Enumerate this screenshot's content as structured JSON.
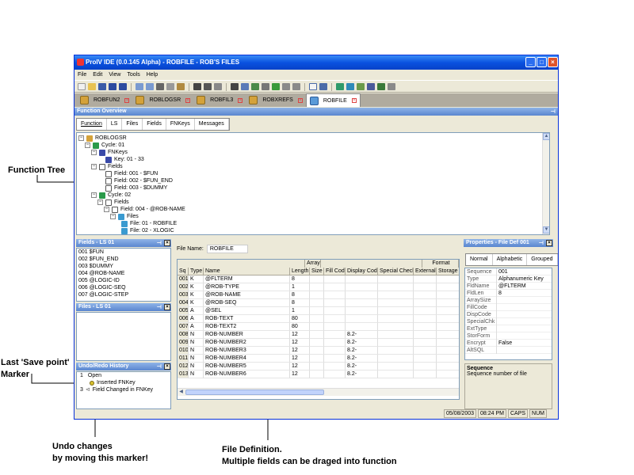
{
  "annotations": {
    "function_tree": "Function Tree",
    "save_point_line1": "Last 'Save point'",
    "save_point_line2": "Marker",
    "undo_line1": "Undo changes",
    "undo_line2": "by moving this marker!",
    "file_def_line1": "File Definition.",
    "file_def_line2": "Multiple fields can be draged into function"
  },
  "window": {
    "title": "ProIV IDE (0.0.145 Alpha) - ROBFILE - ROB'S FILES",
    "min": "_",
    "max": "□",
    "close": "×"
  },
  "menu": [
    "File",
    "Edit",
    "View",
    "Tools",
    "Help"
  ],
  "doc_tabs": [
    {
      "label": "ROBFUN2"
    },
    {
      "label": "ROBLOGSR"
    },
    {
      "label": "ROBFIL3"
    },
    {
      "label": "ROBXREFS"
    },
    {
      "label": "ROBFILE",
      "active": true
    }
  ],
  "function_overview": {
    "title": "Function Overview",
    "tabs": [
      "Function",
      "LS",
      "Files",
      "Fields",
      "FNKeys",
      "Messages"
    ],
    "tree": [
      {
        "label": "ROBLOGSR",
        "icon": "function-icon"
      },
      {
        "label": "Cycle: 01",
        "icon": "cycle-icon"
      },
      {
        "label": "FNKeys",
        "icon": "fnkeys-icon"
      },
      {
        "label": "Key: 01 - 33",
        "icon": "key-icon"
      },
      {
        "label": "Fields",
        "icon": "fields-icon"
      },
      {
        "label": "Field: 001 - $FUN",
        "icon": "field-icon"
      },
      {
        "label": "Field: 002 - $FUN_END",
        "icon": "field-icon"
      },
      {
        "label": "Field: 003 - $DUMMY",
        "icon": "field-icon"
      },
      {
        "label": "Cycle: 02",
        "icon": "cycle-icon"
      },
      {
        "label": "Fields",
        "icon": "fields-icon"
      },
      {
        "label": "Field: 004 - @ROB-NAME",
        "icon": "field-icon"
      },
      {
        "label": "Files",
        "icon": "files-icon"
      },
      {
        "label": "File: 01 - ROBFILE",
        "icon": "file-icon"
      },
      {
        "label": "File: 02 - XLOGIC",
        "icon": "file-icon"
      }
    ]
  },
  "fields_panel": {
    "title": "Fields - LS 01",
    "items": [
      "001 $FUN",
      "002 $FUN_END",
      "003 $DUMMY",
      "004 @ROB-NAME",
      "005 @LOGIC-ID",
      "006 @LOGIC-SEQ",
      "007 @LOGIC-STEP"
    ]
  },
  "files_panel": {
    "title": "Files - LS 01"
  },
  "undo_panel": {
    "title": "Undo/Redo History",
    "items": [
      {
        "num": "1",
        "label": "Open"
      },
      {
        "num": "",
        "label": "Inserted FNKey"
      },
      {
        "num": "3",
        "label": "Field Changed in FNKey"
      }
    ]
  },
  "file_def": {
    "file_name_label": "File Name:",
    "file_name_value": "ROBFILE",
    "group_headers": {
      "array": "Array",
      "format": "Format"
    },
    "columns": [
      "Sq",
      "Type",
      "Name",
      "Length",
      "Size",
      "Fill Code",
      "Display Code",
      "Special Check",
      "External",
      "Storage"
    ],
    "rows": [
      [
        "001",
        "K",
        "@FLTERM",
        "8",
        "",
        "",
        "",
        "",
        "",
        ""
      ],
      [
        "002",
        "K",
        "@ROB-TYPE",
        "1",
        "",
        "",
        "",
        "",
        "",
        ""
      ],
      [
        "003",
        "K",
        "@ROB-NAME",
        "8",
        "",
        "",
        "",
        "",
        "",
        ""
      ],
      [
        "004",
        "K",
        "@ROB-SEQ",
        "8",
        "",
        "",
        "",
        "",
        "",
        ""
      ],
      [
        "005",
        "A",
        "@SEL",
        "1",
        "",
        "",
        "",
        "",
        "",
        ""
      ],
      [
        "006",
        "A",
        "ROB-TEXT",
        "80",
        "",
        "",
        "",
        "",
        "",
        ""
      ],
      [
        "007",
        "A",
        "ROB-TEXT2",
        "80",
        "",
        "",
        "",
        "",
        "",
        ""
      ],
      [
        "008",
        "N",
        "ROB-NUMBER",
        "12",
        "",
        "",
        "8.2-",
        "",
        "",
        ""
      ],
      [
        "009",
        "N",
        "ROB-NUMBER2",
        "12",
        "",
        "",
        "8.2-",
        "",
        "",
        ""
      ],
      [
        "010",
        "N",
        "ROB-NUMBER3",
        "12",
        "",
        "",
        "8.2-",
        "",
        "",
        ""
      ],
      [
        "011",
        "N",
        "ROB-NUMBER4",
        "12",
        "",
        "",
        "8.2-",
        "",
        "",
        ""
      ],
      [
        "012",
        "N",
        "ROB-NUMBER5",
        "12",
        "",
        "",
        "8.2-",
        "",
        "",
        ""
      ],
      [
        "013",
        "N",
        "ROB-NUMBER6",
        "12",
        "",
        "",
        "8.2-",
        "",
        "",
        ""
      ]
    ]
  },
  "properties": {
    "title": "Properties - File Def 001",
    "tabs": [
      "Normal",
      "Alphabetic",
      "Grouped"
    ],
    "rows": [
      [
        "Sequence",
        "001"
      ],
      [
        "Type",
        "Alphanumeric Key"
      ],
      [
        "FldName",
        "@FLTERM"
      ],
      [
        "FldLen",
        "8"
      ],
      [
        "ArraySize",
        ""
      ],
      [
        "FillCode",
        ""
      ],
      [
        "DispCode",
        ""
      ],
      [
        "SpecialChk",
        ""
      ],
      [
        "ExtType",
        ""
      ],
      [
        "StorForm",
        ""
      ],
      [
        "Encrypt",
        "False"
      ],
      [
        "AltSQL",
        ""
      ]
    ],
    "desc_title": "Sequence",
    "desc_text": "Sequence number of file"
  },
  "status": {
    "date": "05/08/2003",
    "time": "08:24 PM",
    "caps": "CAPS",
    "num": "NUM"
  }
}
